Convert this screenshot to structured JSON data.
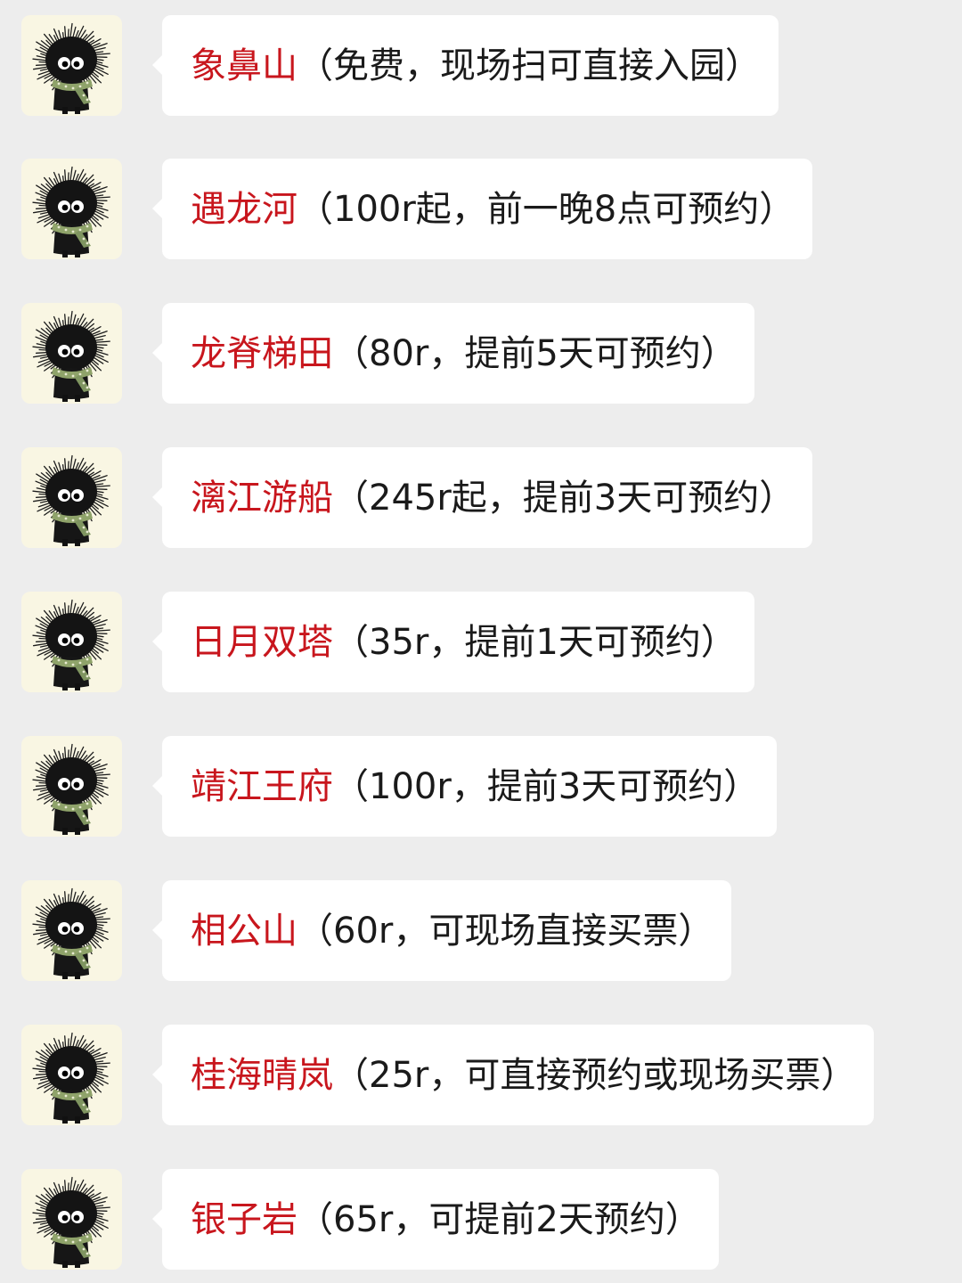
{
  "chat": {
    "messages": [
      {
        "name": "象鼻山",
        "detail": "（免费，现场扫可直接入园）"
      },
      {
        "name": "遇龙河",
        "detail": "（100r起，前一晚8点可预约）"
      },
      {
        "name": "龙脊梯田",
        "detail": "（80r，提前5天可预约）"
      },
      {
        "name": "漓江游船",
        "detail": "（245r起，提前3天可预约）"
      },
      {
        "name": "日月双塔",
        "detail": "（35r，提前1天可预约）"
      },
      {
        "name": "靖江王府",
        "detail": "（100r，提前3天可预约）"
      },
      {
        "name": "相公山",
        "detail": "（60r，可现场直接买票）"
      },
      {
        "name": "桂海晴岚",
        "detail": "（25r，可直接预约或现场买票）"
      },
      {
        "name": "银子岩",
        "detail": "（65r，可提前2天预约）"
      }
    ]
  },
  "colors": {
    "background": "#ededed",
    "bubble": "#ffffff",
    "name_text": "#c8161d",
    "detail_text": "#1a1a1a",
    "avatar_bg": "#f9f6e3"
  },
  "icons": {
    "avatar": "soot-sprite-with-scarf-avatar"
  }
}
